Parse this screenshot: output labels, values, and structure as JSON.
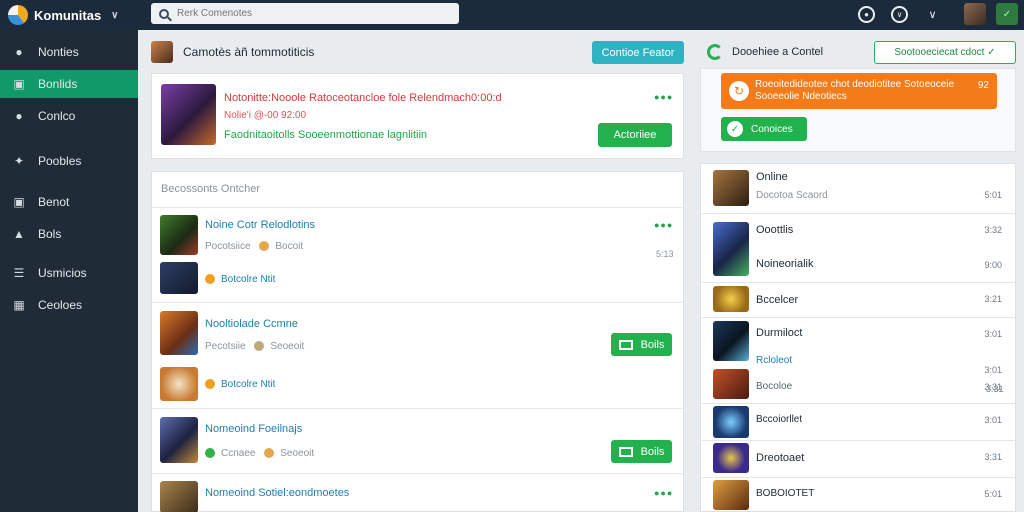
{
  "app": {
    "title": "Komunitas"
  },
  "search": {
    "placeholder": "Rerk Comenotes"
  },
  "sidebar": {
    "items": [
      {
        "label": "Nonties",
        "icon": "people-icon"
      },
      {
        "label": "Bonlids",
        "icon": "chat-icon"
      },
      {
        "label": "Conlco",
        "icon": "chat-bubble-icon"
      },
      {
        "label": "Poobles",
        "icon": "wrench-icon"
      },
      {
        "label": "Benot",
        "icon": "gallery-icon"
      },
      {
        "label": "Bols",
        "icon": "mountain-icon"
      },
      {
        "label": "Usmicios",
        "icon": "sliders-icon"
      },
      {
        "label": "Ceoloes",
        "icon": "grid-icon"
      }
    ]
  },
  "feed": {
    "header_title": "Camotès àñ tommotiticis",
    "header_button": "Contioe Feator",
    "featured": {
      "title": "Notonitte:Nooole Ratoceotancloe fole Relendmach0:00:d",
      "subtitle": "Nolie'i @-00 92:00",
      "tags": "Faodnitaoitolls Sooeenmottionae lagnlitiin",
      "action": "Actoriiee"
    },
    "section_title": "Becossonts Ontcher",
    "posts": [
      {
        "title": "Noine Cotr Relodlotins",
        "meta1": "Pocotsiice",
        "meta2": "Bocoit",
        "count": "5:13",
        "reply": "Botcolre Ntit"
      },
      {
        "title": "Nooltiolade Ccmne",
        "meta1": "Pecotsiie",
        "meta2": "Seoeoit",
        "button": "Boils",
        "reply": "Botcolre Ntit"
      },
      {
        "title": "Nomeoind Foeilnajs",
        "meta1": "Ccnaee",
        "meta2": "Seoeoit",
        "button": "Boils"
      },
      {
        "title": "Nomeoind Sotiel:eondmoetes"
      }
    ]
  },
  "right": {
    "header_title": "Dooehiee a Contel",
    "header_button": "Sootooeciecat cdoct",
    "alert": {
      "line1": "Roeoitedideotee chot deodiotitee Sotoeoceie",
      "line2": "Sooeeolie Ndeotiecs",
      "badge": "92"
    },
    "join_label": "Conoices",
    "friends": [
      {
        "name": "Online",
        "sub": "Docotoa Scaord",
        "num": "5:01"
      },
      {
        "name": "Ooottlis",
        "num": "3:32"
      },
      {
        "name": "Noineorialik",
        "num": "9:00"
      },
      {
        "name": "Bccelcer",
        "num": "3:21"
      },
      {
        "name": "Durmiloct",
        "sub": "Rcloleot",
        "num": "3:01"
      },
      {
        "name": "Bocoloe",
        "num": "3:31"
      },
      {
        "name": "Bccoiorllet",
        "num": "3:01"
      },
      {
        "name": "Dreotoaet",
        "num": "3:31"
      },
      {
        "name": "BOBOIOTET",
        "num": "5:01"
      }
    ],
    "extra_nums": [
      "3:01",
      "3:31"
    ]
  },
  "colors": {
    "topbar": "#1b2b3b",
    "sidebar": "#1f2b36",
    "active": "#12996a",
    "accent_green": "#23b14d",
    "accent_orange": "#f47b1a",
    "accent_teal": "#2fb3c2"
  }
}
